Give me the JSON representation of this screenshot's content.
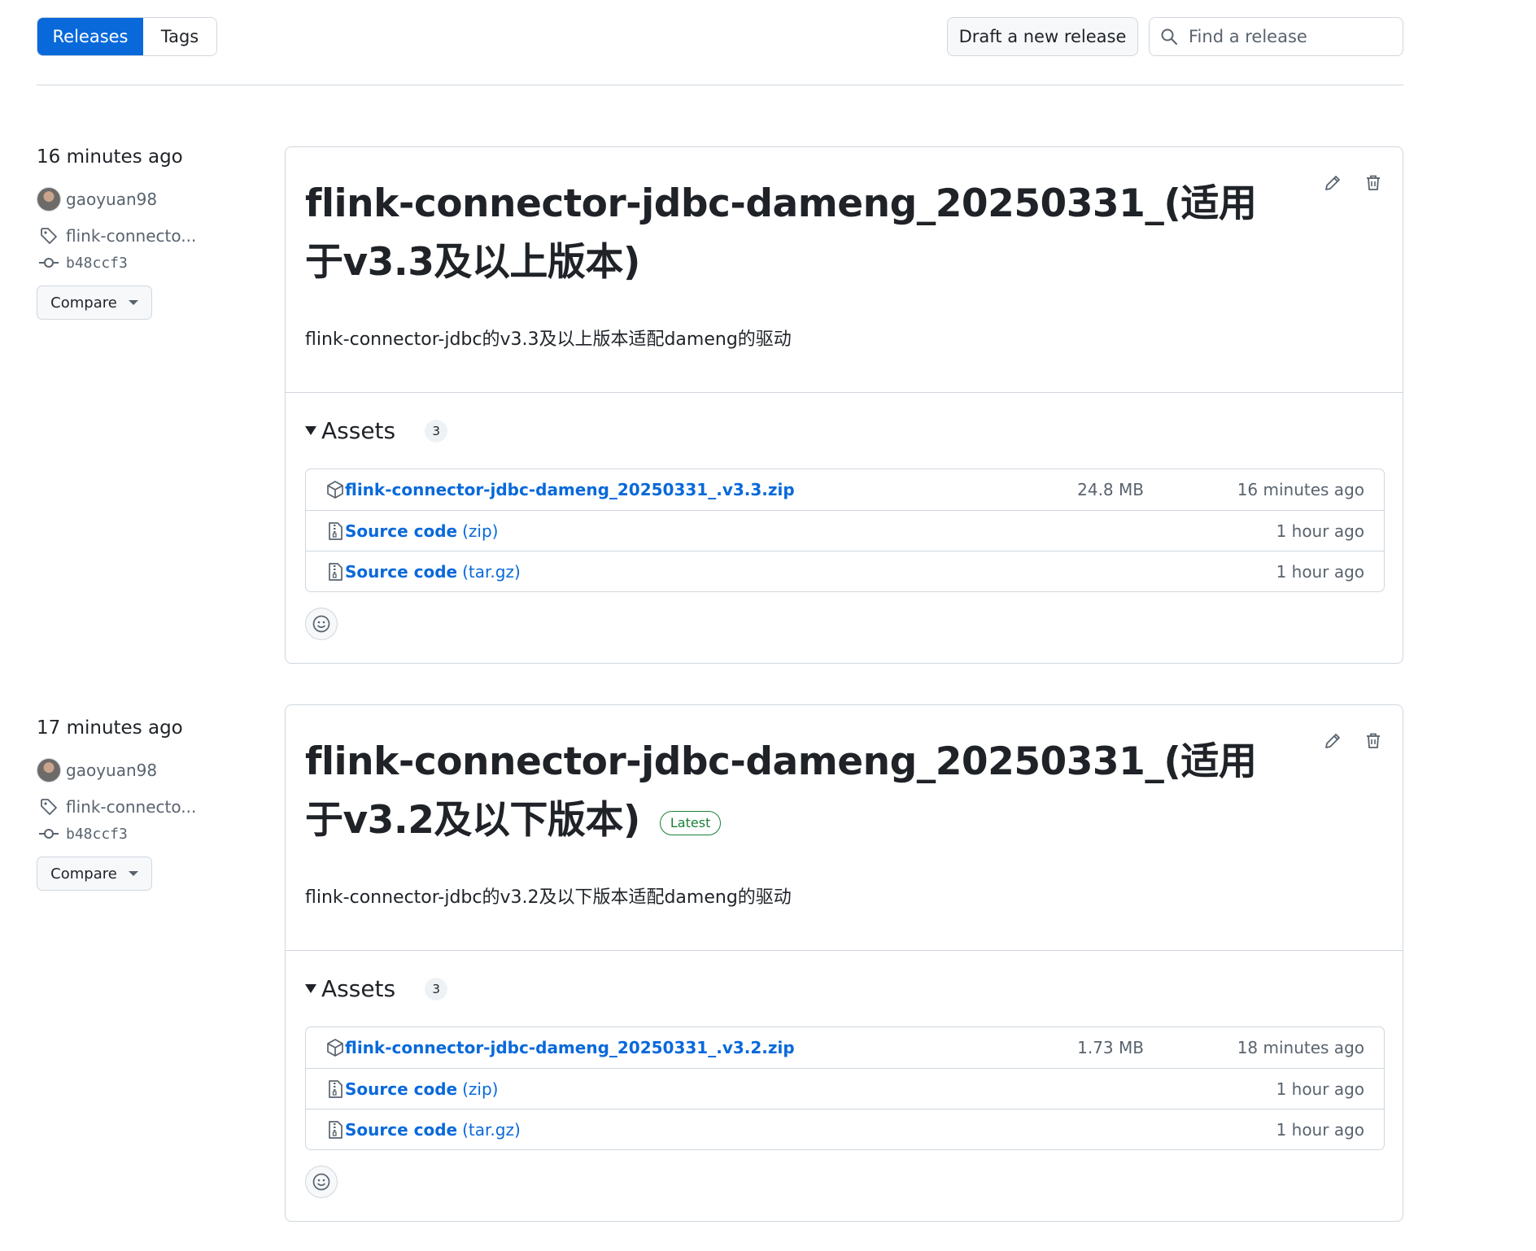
{
  "tabs": {
    "releases": "Releases",
    "tags": "Tags"
  },
  "draft_button": "Draft a new release",
  "search": {
    "placeholder": "Find a release"
  },
  "releases": [
    {
      "time": "16 minutes ago",
      "author": "gaoyuan98",
      "tag": "flink-connecto...",
      "commit": "b48ccf3",
      "compare": "Compare",
      "title": "flink-connector-jdbc-dameng_20250331_(适用于v3.3及以上版本)",
      "latest_label": "",
      "description": "flink-connector-jdbc的v3.3及以上版本适配dameng的驱动",
      "assets_label": "Assets",
      "assets_count": "3",
      "assets": [
        {
          "name": "flink-connector-jdbc-dameng_20250331_.v3.3.zip",
          "ext": "",
          "size": "24.8 MB",
          "time": "16 minutes ago",
          "icon": "package-icon"
        },
        {
          "name": "Source code",
          "ext": "(zip)",
          "size": "",
          "time": "1 hour ago",
          "icon": "file-zip-icon"
        },
        {
          "name": "Source code",
          "ext": "(tar.gz)",
          "size": "",
          "time": "1 hour ago",
          "icon": "file-zip-icon"
        }
      ]
    },
    {
      "time": "17 minutes ago",
      "author": "gaoyuan98",
      "tag": "flink-connecto...",
      "commit": "b48ccf3",
      "compare": "Compare",
      "title": "flink-connector-jdbc-dameng_20250331_(适用于v3.2及以下版本)",
      "latest_label": "Latest",
      "description": "flink-connector-jdbc的v3.2及以下版本适配dameng的驱动",
      "assets_label": "Assets",
      "assets_count": "3",
      "assets": [
        {
          "name": "flink-connector-jdbc-dameng_20250331_.v3.2.zip",
          "ext": "",
          "size": "1.73 MB",
          "time": "18 minutes ago",
          "icon": "package-icon"
        },
        {
          "name": "Source code",
          "ext": "(zip)",
          "size": "",
          "time": "1 hour ago",
          "icon": "file-zip-icon"
        },
        {
          "name": "Source code",
          "ext": "(tar.gz)",
          "size": "",
          "time": "1 hour ago",
          "icon": "file-zip-icon"
        }
      ]
    }
  ],
  "colors": {
    "accent": "#0969da",
    "border": "#d0d7de",
    "muted": "#59636e",
    "success": "#1a7f37"
  }
}
